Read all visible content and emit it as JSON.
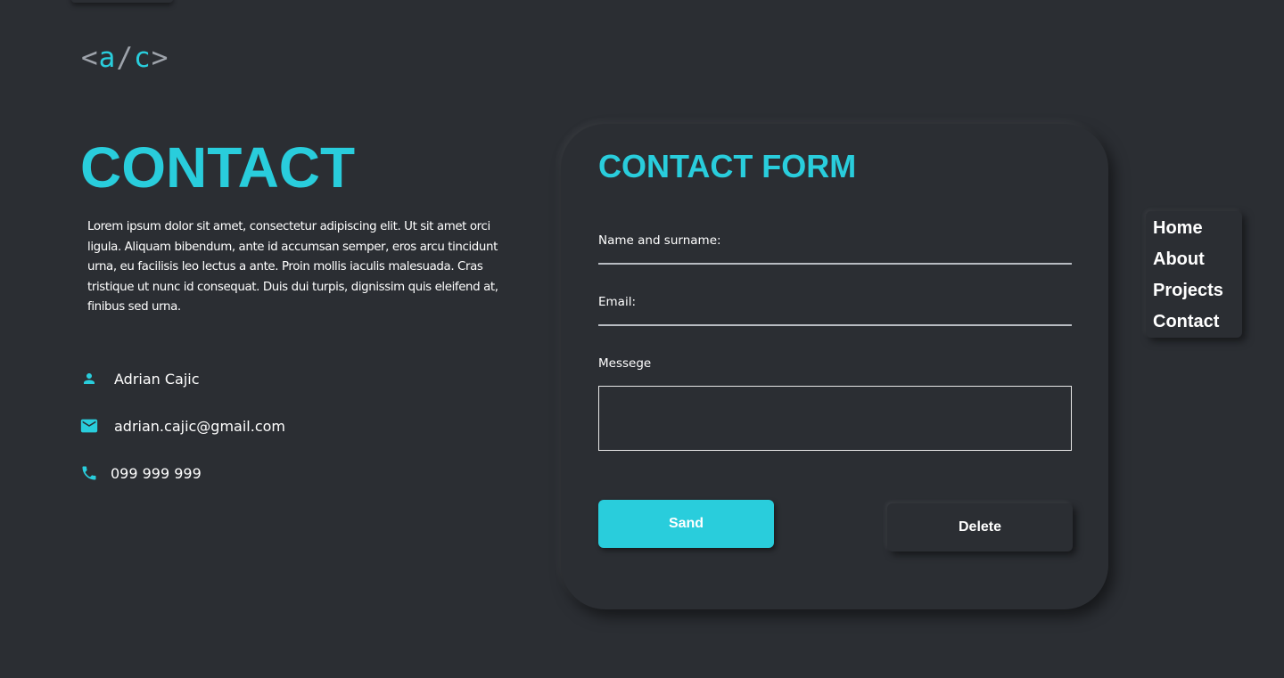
{
  "logo": {
    "open_bracket": "<",
    "letter_a": "a",
    "slash": "/",
    "letter_c": "c",
    "close_bracket": ">"
  },
  "page": {
    "title": "CONTACT",
    "intro": "Lorem ipsum dolor sit amet, consectetur adipiscing elit. Ut sit amet orci ligula. Aliquam bibendum, ante id accumsan semper, eros arcu tincidunt urna, eu facilisis leo lectus a ante. Proin mollis iaculis malesuada. Cras tristique ut nunc id consequat. Duis dui turpis, dignissim quis eleifend at, finibus sed urna."
  },
  "contact_info": {
    "name": "Adrian Cajic",
    "email": "adrian.cajic@gmail.com",
    "phone": "099 999 999"
  },
  "form": {
    "title": "CONTACT FORM",
    "name_label": "Name and surname:",
    "name_value": "",
    "email_label": "Email:",
    "email_value": "",
    "message_label": "Messege",
    "message_value": "",
    "send_label": "Sand",
    "delete_label": "Delete"
  },
  "nav": {
    "items": [
      {
        "label": "Home"
      },
      {
        "label": "About"
      },
      {
        "label": "Projects"
      },
      {
        "label": "Contact"
      }
    ]
  },
  "icons": {
    "person": "person-icon",
    "mail": "mail-icon",
    "phone": "phone-icon"
  },
  "colors": {
    "background": "#2b2e33",
    "accent": "#29cddc",
    "text": "#ffffff",
    "bracket": "#9ea3ab"
  }
}
